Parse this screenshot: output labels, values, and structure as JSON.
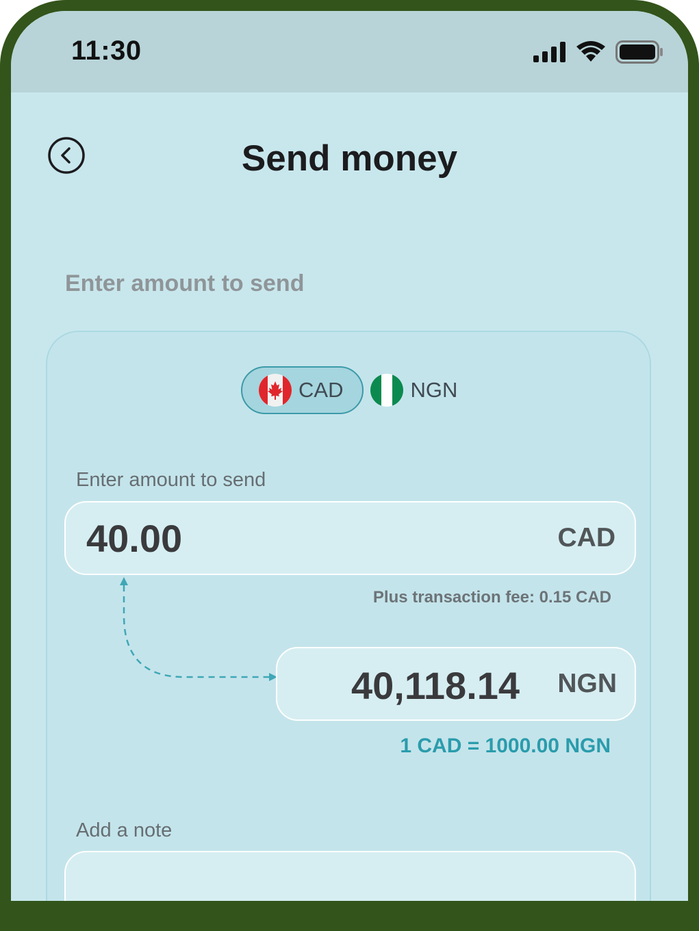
{
  "status_bar": {
    "time": "11:30",
    "icons": [
      "signal-icon",
      "wifi-icon",
      "battery-icon"
    ]
  },
  "header": {
    "title": "Send money",
    "back_icon": "chevron-left-icon"
  },
  "section_label": "Enter amount to send",
  "currency_toggle": {
    "options": [
      {
        "code": "CAD",
        "flag": "canada-flag-icon",
        "selected": true
      },
      {
        "code": "NGN",
        "flag": "nigeria-flag-icon",
        "selected": false
      }
    ]
  },
  "amount_field": {
    "label": "Enter amount to send",
    "value": "40.00",
    "currency": "CAD"
  },
  "fee_text": "Plus transaction fee: 0.15 CAD",
  "converted": {
    "value": "40,118.14",
    "currency": "NGN"
  },
  "rate_text": "1 CAD = 1000.00 NGN",
  "note_field": {
    "label": "Add a note",
    "value": ""
  },
  "colors": {
    "frame": "#33541a",
    "screen_bg": "#c8e7ed",
    "status_bg": "#b8d4d8",
    "accent": "#2a9cac",
    "active_pill": "#a5d5de"
  }
}
